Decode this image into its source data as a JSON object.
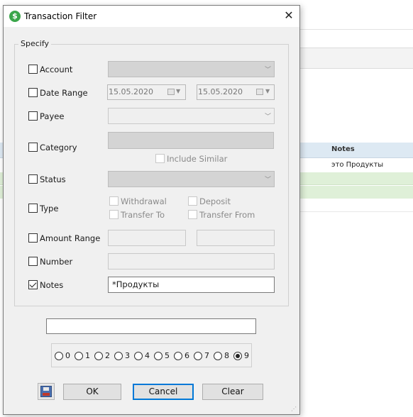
{
  "background": {
    "notes_header": "Notes",
    "row1_notes": "это Продукты"
  },
  "dialog": {
    "title": "Transaction Filter",
    "close_glyph": "✕",
    "group_title": "Specify",
    "rows": {
      "account": {
        "label": "Account",
        "checked": false
      },
      "date_range": {
        "label": "Date Range",
        "checked": false,
        "from": "15.05.2020",
        "to": "15.05.2020"
      },
      "payee": {
        "label": "Payee",
        "checked": false
      },
      "category": {
        "label": "Category",
        "checked": false,
        "include_similar": "Include Similar"
      },
      "status": {
        "label": "Status",
        "checked": false
      },
      "type": {
        "label": "Type",
        "checked": false,
        "withdrawal": "Withdrawal",
        "deposit": "Deposit",
        "transfer_to": "Transfer To",
        "transfer_from": "Transfer From"
      },
      "amount_range": {
        "label": "Amount Range",
        "checked": false
      },
      "number": {
        "label": "Number",
        "checked": false
      },
      "notes": {
        "label": "Notes",
        "checked": true,
        "value": "*Продукты"
      }
    },
    "free_text_value": "",
    "color_radios": [
      "0",
      "1",
      "2",
      "3",
      "4",
      "5",
      "6",
      "7",
      "8",
      "9"
    ],
    "selected_radio": "9",
    "buttons": {
      "ok": "OK",
      "cancel": "Cancel",
      "clear": "Clear"
    },
    "icons": {
      "app": "dollar-coin-icon",
      "save": "floppy-disk-icon",
      "close": "close-icon",
      "resize": "resize-grip-icon"
    },
    "colors": {
      "accent": "#0078d7",
      "checked_notes_bg": "#ffffff",
      "highlight_rows": "#dff0d8",
      "table_header": "#dde9f3"
    }
  }
}
